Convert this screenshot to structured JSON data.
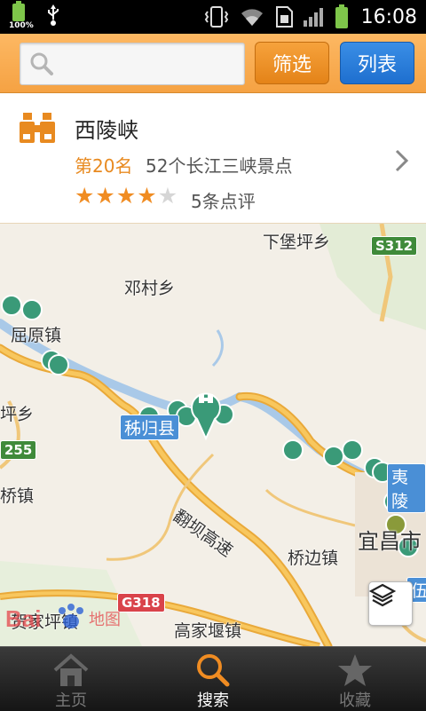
{
  "status_bar": {
    "battery_small_label": "100%",
    "time": "16:08"
  },
  "search": {
    "placeholder": "",
    "filter_label": "筛选",
    "list_label": "列表"
  },
  "poi_card": {
    "title": "西陵峡",
    "rank": "第20名",
    "category": "52个长江三峡景点",
    "rating": 4,
    "rating_max": 5,
    "reviews": "5条点评"
  },
  "map": {
    "place_labels": [
      {
        "id": "xiabaopingxiang",
        "text": "下堡坪乡"
      },
      {
        "id": "dengcunxiang",
        "text": "邓村乡"
      },
      {
        "id": "quyuanzhen",
        "text": "屈原镇"
      },
      {
        "id": "pingxiang",
        "text": "坪乡"
      },
      {
        "id": "qiaozhen",
        "text": "桥镇"
      },
      {
        "id": "qiaobianzhen",
        "text": "桥边镇"
      },
      {
        "id": "gaojiayanzhen",
        "text": "高家堰镇"
      },
      {
        "id": "yichangshi",
        "text": "宜昌市"
      },
      {
        "id": "hejiapingzhen",
        "text": "贺家坪镇"
      }
    ],
    "road_label": "翻坝高速",
    "shields": [
      {
        "id": "s312",
        "text": "S312"
      },
      {
        "id": "n255",
        "text": "255"
      },
      {
        "id": "g318",
        "text": "G318"
      }
    ],
    "county_labels": [
      {
        "id": "zigui",
        "text": "秭归县"
      },
      {
        "id": "yiling",
        "text": "夷陵"
      },
      {
        "id": "wu",
        "text": "伍"
      }
    ],
    "watermark_text": "地图"
  },
  "tabs": [
    {
      "label": "主页",
      "icon": "home-icon",
      "active": false
    },
    {
      "label": "搜索",
      "icon": "search-icon",
      "active": true
    },
    {
      "label": "收藏",
      "icon": "star-icon",
      "active": false
    }
  ],
  "colors": {
    "orange_accent": "#e88a20",
    "blue_button": "#1e6fcf",
    "marker_green": "#3a9a78",
    "river_blue": "#a9c9e8"
  }
}
